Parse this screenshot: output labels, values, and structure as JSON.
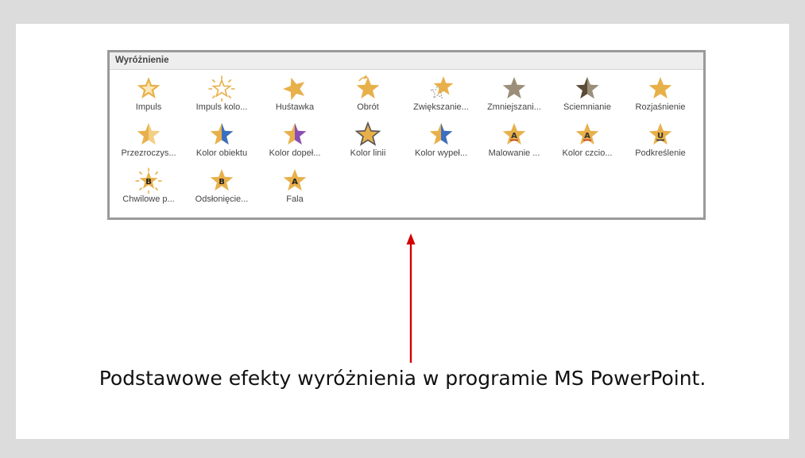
{
  "gallery": {
    "title": "Wyróżnienie",
    "items": [
      {
        "label": "Impuls",
        "icon": "pulse-star-icon"
      },
      {
        "label": "Impuls kolo...",
        "icon": "color-pulse-star-icon"
      },
      {
        "label": "Huśtawka",
        "icon": "teeter-star-icon"
      },
      {
        "label": "Obrót",
        "icon": "spin-star-icon"
      },
      {
        "label": "Zwiększanie...",
        "icon": "grow-star-icon"
      },
      {
        "label": "Zmniejszani...",
        "icon": "desaturate-star-icon"
      },
      {
        "label": "Ściemnianie",
        "icon": "darken-star-icon"
      },
      {
        "label": "Rozjaśnienie",
        "icon": "lighten-star-icon"
      },
      {
        "label": "Przezroczys...",
        "icon": "transparency-star-icon"
      },
      {
        "label": "Kolor obiektu",
        "icon": "object-color-star-icon"
      },
      {
        "label": "Kolor dopeł...",
        "icon": "complementary-color-star-icon"
      },
      {
        "label": "Kolor linii",
        "icon": "line-color-star-icon"
      },
      {
        "label": "Kolor wypeł...",
        "icon": "fill-color-star-icon"
      },
      {
        "label": "Malowanie ...",
        "icon": "brush-color-star-icon"
      },
      {
        "label": "Kolor czcio...",
        "icon": "font-color-star-icon"
      },
      {
        "label": "Podkreślenie",
        "icon": "underline-star-icon"
      },
      {
        "label": "Chwilowe p...",
        "icon": "bold-flash-star-icon"
      },
      {
        "label": "Odsłonięcie...",
        "icon": "bold-reveal-star-icon"
      },
      {
        "label": "Fala",
        "icon": "wave-star-icon"
      }
    ]
  },
  "caption": "Podstawowe efekty wyróżnienia w programie MS PowerPoint.",
  "colors": {
    "star_gold": "#e8b04a",
    "star_light": "#f3cf86",
    "star_blue": "#3b6fc0",
    "star_purple": "#8a4fb5",
    "star_gray": "#9b8f7a",
    "star_dark": "#5a4a36",
    "arrow_red": "#d40000"
  }
}
